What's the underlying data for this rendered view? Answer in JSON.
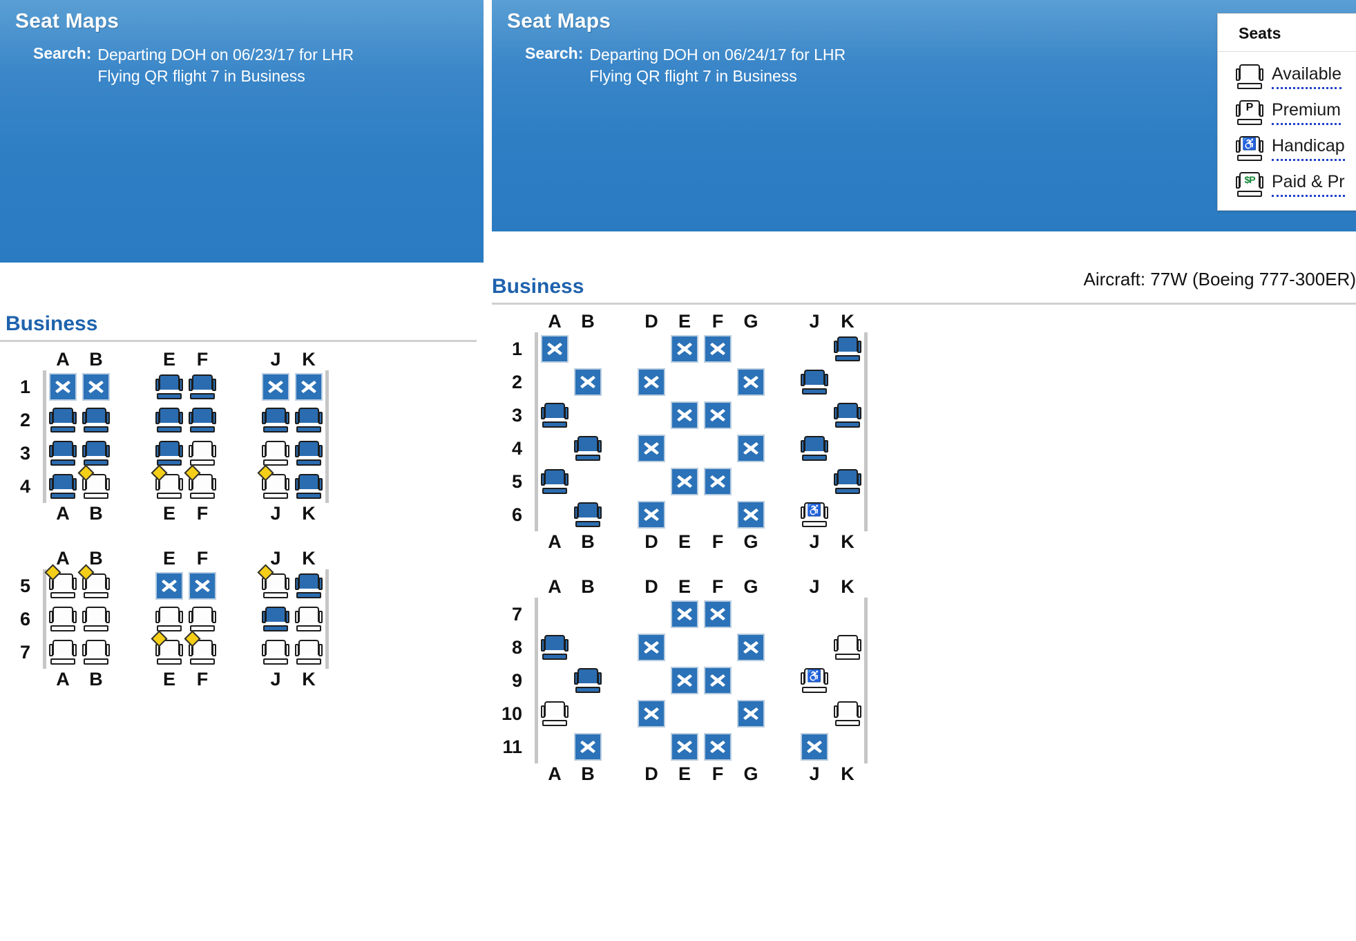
{
  "panels": [
    {
      "title": "Seat Maps",
      "search_label": "Search:",
      "search_line1": "Departing DOH on 06/23/17 for LHR",
      "search_line2": "Flying QR flight 7 in Business"
    },
    {
      "title": "Seat Maps",
      "search_label": "Search:",
      "search_line1": "Departing DOH on 06/24/17 for LHR",
      "search_line2": "Flying QR flight 7 in Business"
    }
  ],
  "legend": {
    "title": "Seats",
    "items": [
      {
        "label": "Available",
        "icon": "seat-available-icon"
      },
      {
        "label": "Premium",
        "icon": "seat-premium-icon"
      },
      {
        "label": "Handicap",
        "icon": "seat-handicap-icon"
      },
      {
        "label": "Paid & Pr",
        "icon": "seat-paid-premium-icon"
      }
    ]
  },
  "aircraft": "Aircraft: 77W (Boeing 777-300ER)",
  "accent_color": "#2b72b8",
  "heading_color": "#1e62ad",
  "left_map": {
    "cabin": "Business",
    "columns": [
      "A",
      "B",
      "E",
      "F",
      "J",
      "K"
    ],
    "sections": [
      {
        "rows": [
          {
            "num": "1",
            "seats": [
              "occupied",
              "occupied",
              "available-blue",
              "available-blue",
              "occupied",
              "occupied"
            ]
          },
          {
            "num": "2",
            "seats": [
              "available-blue",
              "available-blue",
              "available-blue",
              "available-blue",
              "available-blue",
              "available-blue"
            ]
          },
          {
            "num": "3",
            "seats": [
              "available-blue",
              "available-blue",
              "available-blue",
              "available",
              "available",
              "available-blue"
            ]
          },
          {
            "num": "4",
            "seats": [
              "available-blue",
              "available-prem",
              "available-prem",
              "available-prem",
              "available-prem",
              "available-blue"
            ]
          }
        ]
      },
      {
        "rows": [
          {
            "num": "5",
            "seats": [
              "available-prem",
              "available-prem",
              "occupied",
              "occupied",
              "available-prem",
              "available-blue"
            ]
          },
          {
            "num": "6",
            "seats": [
              "available",
              "available",
              "available",
              "available",
              "available-blue",
              "available"
            ]
          },
          {
            "num": "7",
            "seats": [
              "available",
              "available",
              "available-prem",
              "available-prem",
              "available",
              "available"
            ]
          }
        ]
      }
    ]
  },
  "right_map": {
    "cabin": "Business",
    "columns": [
      "A",
      "B",
      "D",
      "E",
      "F",
      "G",
      "J",
      "K"
    ],
    "sections": [
      {
        "rows": [
          {
            "num": "1",
            "seats": [
              "occupied",
              "empty",
              "empty",
              "occupied",
              "occupied",
              "empty",
              "empty",
              "available-blue"
            ]
          },
          {
            "num": "2",
            "seats": [
              "empty",
              "occupied",
              "occupied",
              "empty",
              "empty",
              "occupied",
              "available-blue",
              "empty"
            ]
          },
          {
            "num": "3",
            "seats": [
              "available-blue",
              "empty",
              "empty",
              "occupied",
              "occupied",
              "empty",
              "empty",
              "available-blue"
            ]
          },
          {
            "num": "4",
            "seats": [
              "empty",
              "available-blue",
              "occupied",
              "empty",
              "empty",
              "occupied",
              "available-blue",
              "empty"
            ]
          },
          {
            "num": "5",
            "seats": [
              "available-blue",
              "empty",
              "empty",
              "occupied",
              "occupied",
              "empty",
              "empty",
              "available-blue"
            ]
          },
          {
            "num": "6",
            "seats": [
              "empty",
              "available-blue",
              "occupied",
              "empty",
              "empty",
              "occupied",
              "available-handicap",
              "empty"
            ]
          }
        ]
      },
      {
        "rows": [
          {
            "num": "7",
            "seats": [
              "empty",
              "empty",
              "empty",
              "occupied",
              "occupied",
              "empty",
              "empty",
              "empty"
            ]
          },
          {
            "num": "8",
            "seats": [
              "available-blue",
              "empty",
              "occupied",
              "empty",
              "empty",
              "occupied",
              "empty",
              "available"
            ]
          },
          {
            "num": "9",
            "seats": [
              "empty",
              "available-blue",
              "empty",
              "occupied",
              "occupied",
              "empty",
              "available-handicap",
              "empty"
            ]
          },
          {
            "num": "10",
            "seats": [
              "available",
              "empty",
              "occupied",
              "empty",
              "empty",
              "occupied",
              "empty",
              "available"
            ]
          },
          {
            "num": "11",
            "seats": [
              "empty",
              "occupied",
              "empty",
              "occupied",
              "occupied",
              "empty",
              "occupied",
              "empty"
            ]
          }
        ]
      }
    ]
  }
}
